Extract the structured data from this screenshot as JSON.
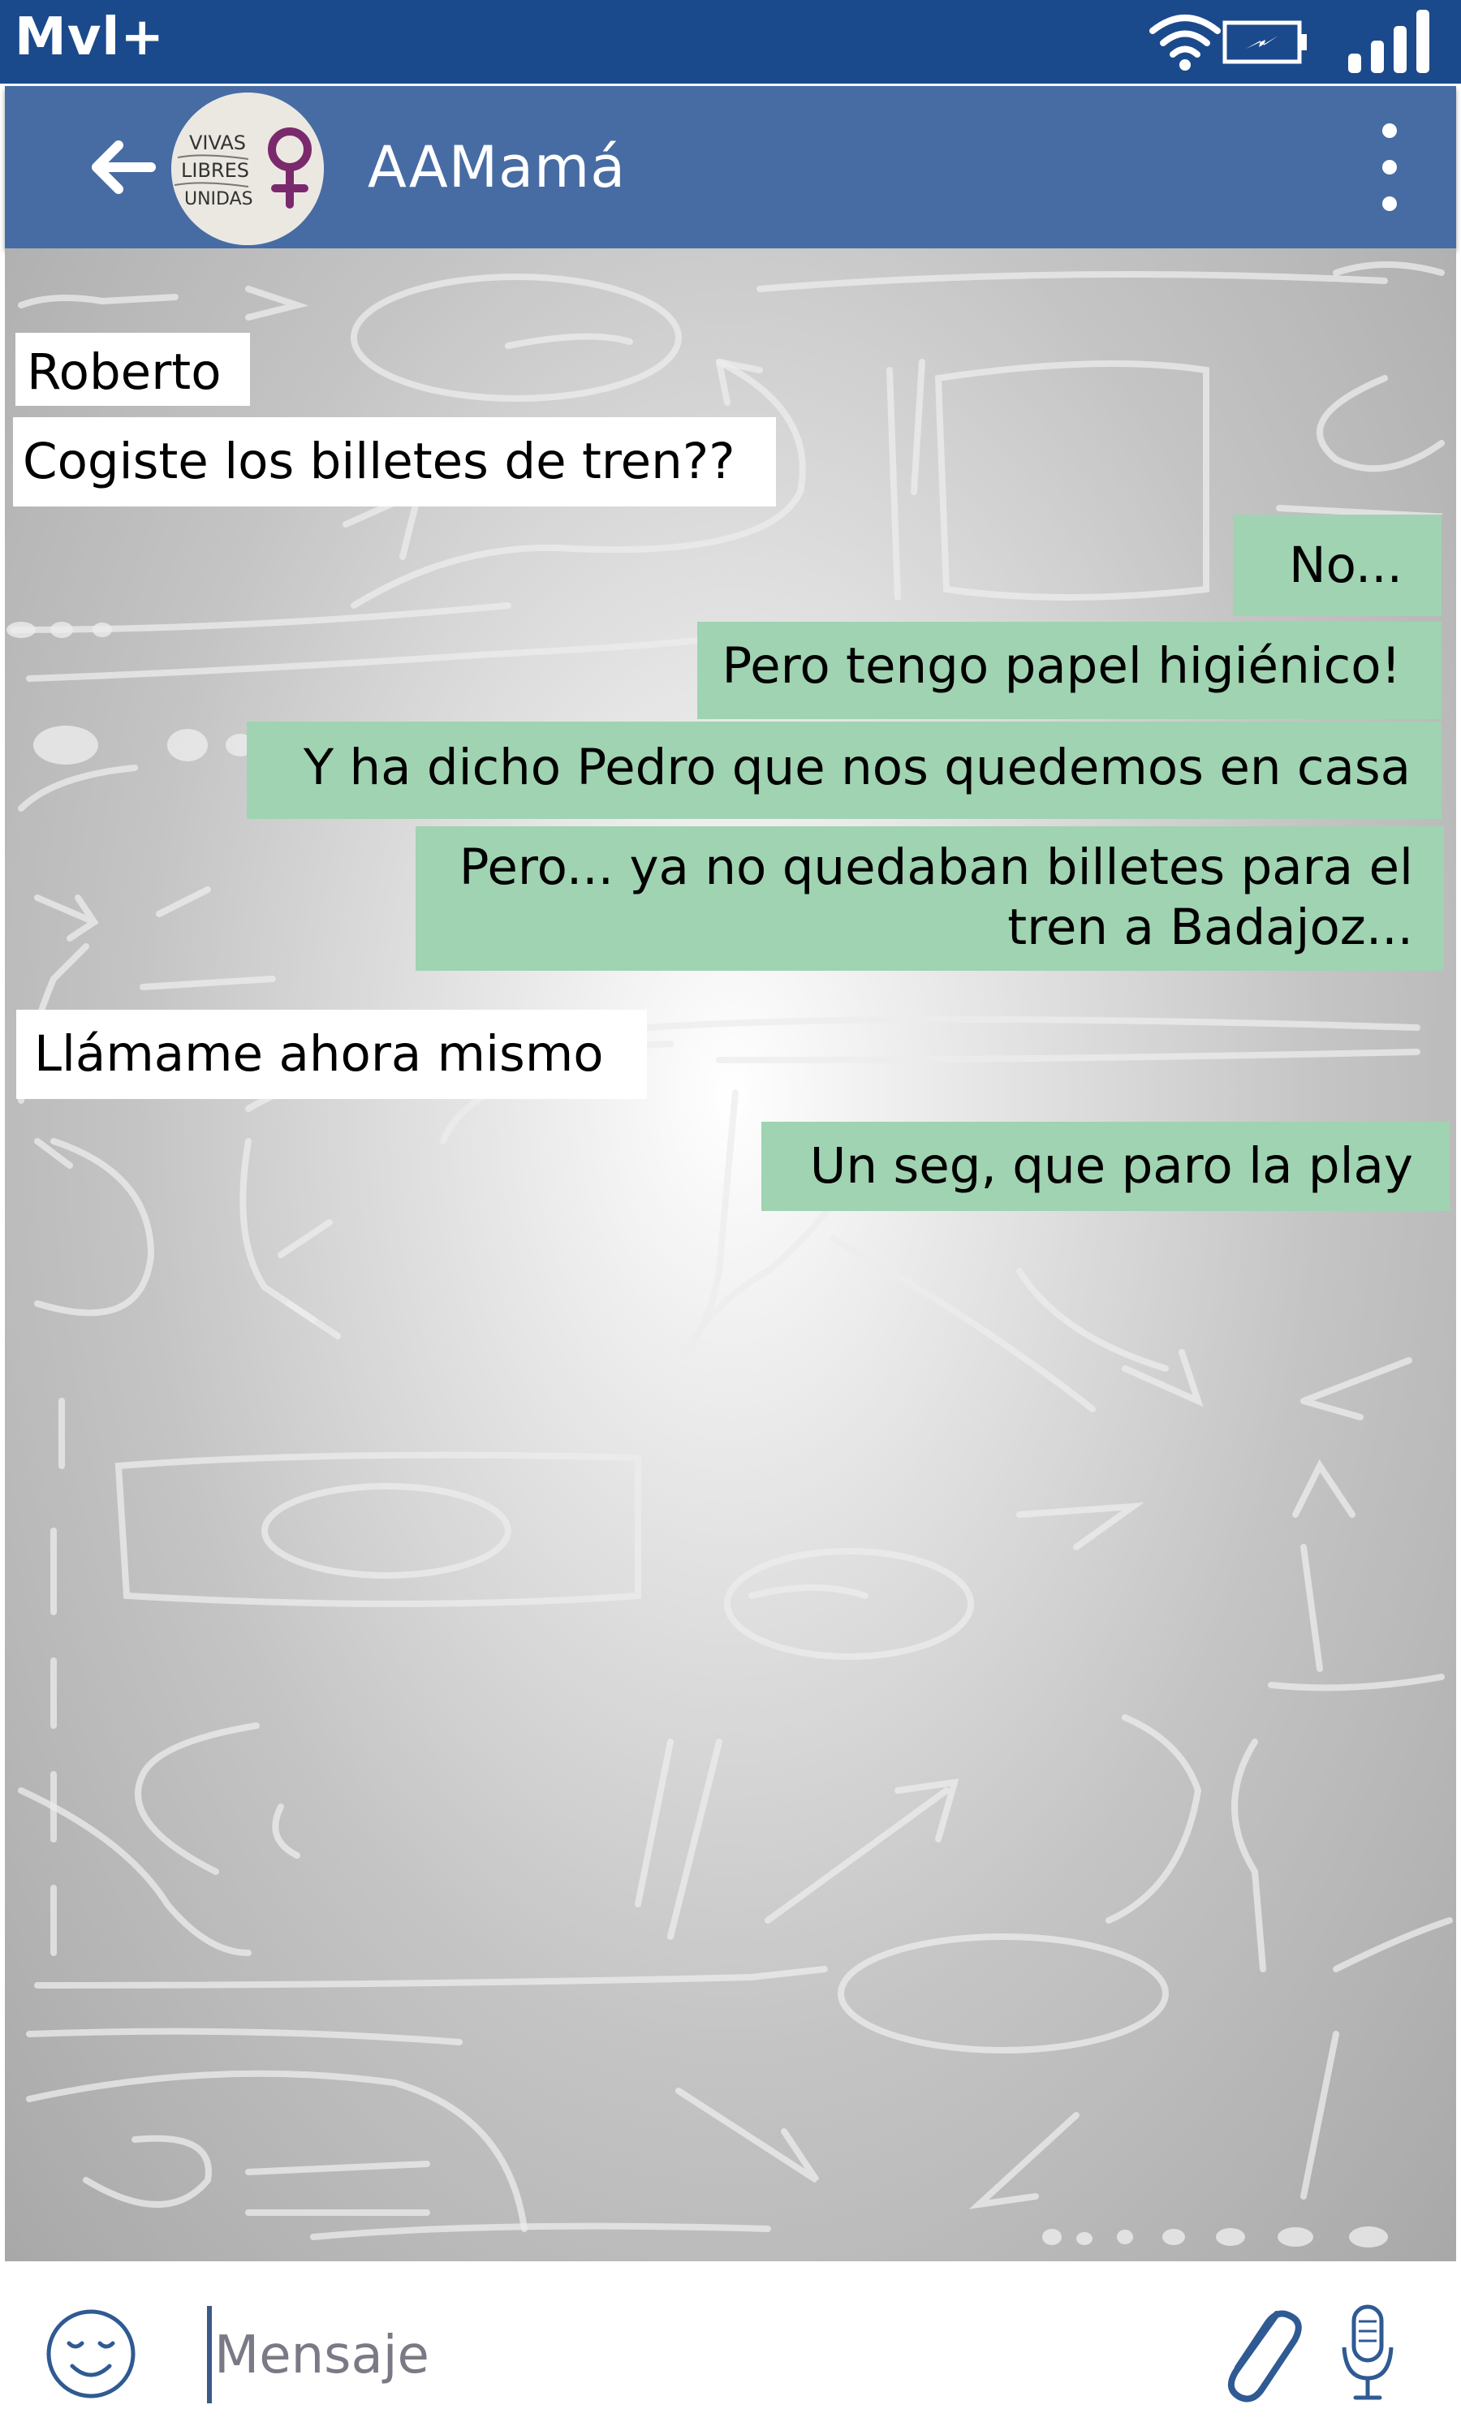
{
  "status_bar": {
    "carrier": "Mvl+"
  },
  "header": {
    "title": "AAMamá",
    "avatar_text": [
      "VIVAS",
      "LIBRES",
      "UNIDAS"
    ],
    "icons": {
      "back": "arrow-left-icon",
      "menu": "more-vertical-icon"
    }
  },
  "messages": [
    {
      "direction": "incoming",
      "text": "Roberto"
    },
    {
      "direction": "incoming",
      "text": "Cogiste los billetes de tren??"
    },
    {
      "direction": "outgoing",
      "text": "No..."
    },
    {
      "direction": "outgoing",
      "text": "Pero tengo papel higiénico!"
    },
    {
      "direction": "outgoing",
      "text": "Y ha dicho Pedro que nos quedemos en casa"
    },
    {
      "direction": "outgoing",
      "lines": [
        "Pero... ya no quedaban billetes para el",
        "tren a Badajoz..."
      ]
    },
    {
      "direction": "incoming",
      "text": "Llámame ahora mismo"
    },
    {
      "direction": "outgoing",
      "text": "Un seg, que paro la play"
    }
  ],
  "composer": {
    "placeholder": "Mensaje",
    "icons": {
      "emoji": "smiley-icon",
      "attach": "paperclip-icon",
      "mic": "microphone-icon"
    }
  },
  "colors": {
    "status_bar": "#1b4a8c",
    "app_bar": "#476ca3",
    "outgoing_bubble": "#a0d3b1",
    "incoming_bubble": "#ffffff"
  }
}
